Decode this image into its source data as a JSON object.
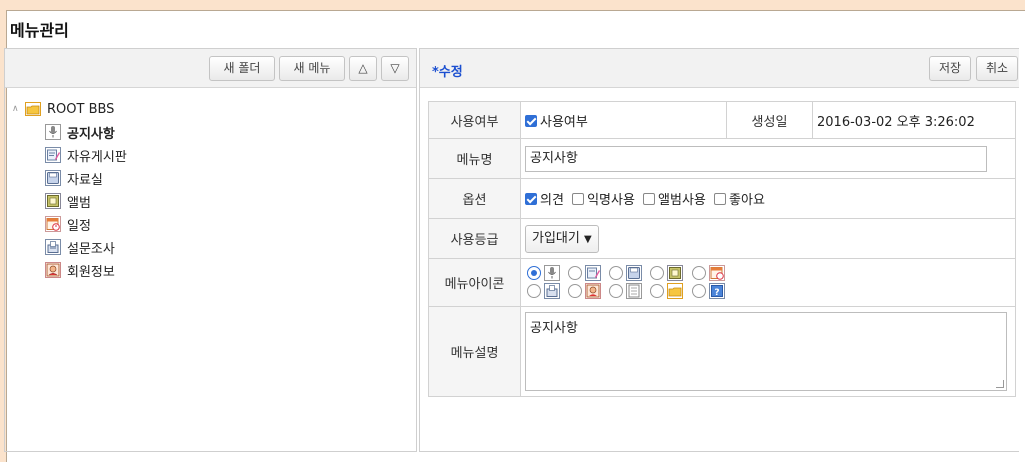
{
  "page": {
    "title": "메뉴관리"
  },
  "left": {
    "toolbar": {
      "new_folder": "새 폴더",
      "new_menu": "새 메뉴",
      "move_up": "△",
      "move_down": "▽"
    },
    "tree": {
      "root": {
        "label": "ROOT BBS",
        "icon": "folder-icon"
      },
      "items": [
        {
          "label": "공지사항",
          "icon": "microphone-icon",
          "selected": true
        },
        {
          "label": "자유게시판",
          "icon": "notepad-icon"
        },
        {
          "label": "자료실",
          "icon": "disk-icon"
        },
        {
          "label": "앨범",
          "icon": "photo-icon"
        },
        {
          "label": "일정",
          "icon": "calendar-icon"
        },
        {
          "label": "설문조사",
          "icon": "ballot-icon"
        },
        {
          "label": "회원정보",
          "icon": "member-icon"
        }
      ]
    }
  },
  "right": {
    "title": "*수정",
    "save": "저장",
    "cancel": "취소",
    "form": {
      "use_label": "사용여부",
      "use_check": "사용여부",
      "created_label": "생성일",
      "created_value": "2016-03-02 오후 3:26:02",
      "name_label": "메뉴명",
      "name_value": "공지사항",
      "option_label": "옵션",
      "options": [
        {
          "label": "의견",
          "checked": true
        },
        {
          "label": "익명사용",
          "checked": false
        },
        {
          "label": "앨범사용",
          "checked": false
        },
        {
          "label": "좋아요",
          "checked": false
        }
      ],
      "grade_label": "사용등급",
      "grade_value": "가입대기",
      "icon_label": "메뉴아이콘",
      "icon_row1": [
        "microphone-icon",
        "notepad-icon",
        "disk-icon",
        "photo-icon",
        "calendar-icon"
      ],
      "icon_row2": [
        "ballot-icon",
        "member-icon",
        "document-icon",
        "folder-icon",
        "help-icon"
      ],
      "selected_icon": "microphone-icon",
      "desc_label": "메뉴설명",
      "desc_value": "공지사항"
    }
  }
}
